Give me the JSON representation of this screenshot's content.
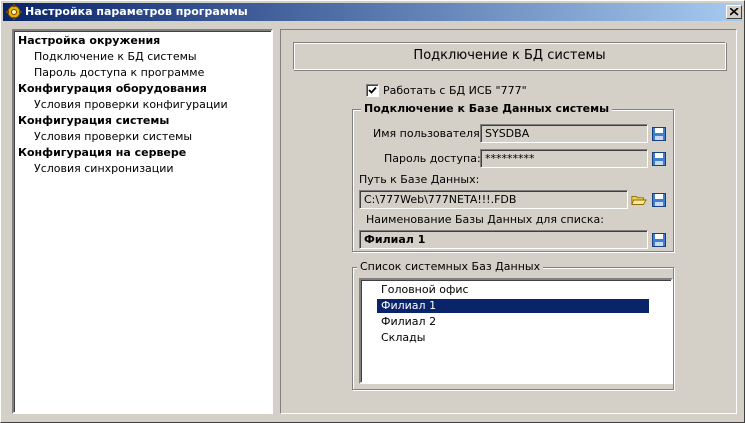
{
  "window": {
    "title": "Настройка параметров программы",
    "close_icon": "close-icon"
  },
  "tree": {
    "items": [
      {
        "label": "Настройка окружения",
        "level": 0
      },
      {
        "label": "Подключение к БД системы",
        "level": 1
      },
      {
        "label": "Пароль доступа к программе",
        "level": 1
      },
      {
        "label": "Конфигурация оборудования",
        "level": 0
      },
      {
        "label": "Условия проверки конфигурации",
        "level": 1
      },
      {
        "label": "Конфигурация системы",
        "level": 0
      },
      {
        "label": "Условия проверки системы",
        "level": 1
      },
      {
        "label": "Конфигурация на сервере",
        "level": 0
      },
      {
        "label": "Условия синхронизации",
        "level": 1
      }
    ]
  },
  "panel": {
    "header": "Подключение к БД системы",
    "use_db_checkbox": {
      "label": "Работать с БД ИСБ \"777\"",
      "checked": true
    },
    "db_group": {
      "legend": "Подключение к Базе Данных системы",
      "username_label": "Имя пользователя:",
      "username_value": "SYSDBA",
      "password_label": "Пароль доступа:",
      "password_value": "*********",
      "path_label": "Путь к Базе Данных:",
      "path_value": "C:\\777Web\\777NETA!!!.FDB",
      "dbname_label": "Наименование Базы Данных для списка:",
      "dbname_value": "Филиал 1"
    },
    "list_group": {
      "legend": "Список системных Баз Данных",
      "items": [
        "Головной офис",
        "Филиал 1",
        "Филиал 2",
        "Склады"
      ],
      "selected_index": 1
    }
  },
  "colors": {
    "titlebar_start": "#0a246a",
    "titlebar_end": "#a6caf0",
    "selection": "#0a246a",
    "face": "#d4d0c8"
  }
}
